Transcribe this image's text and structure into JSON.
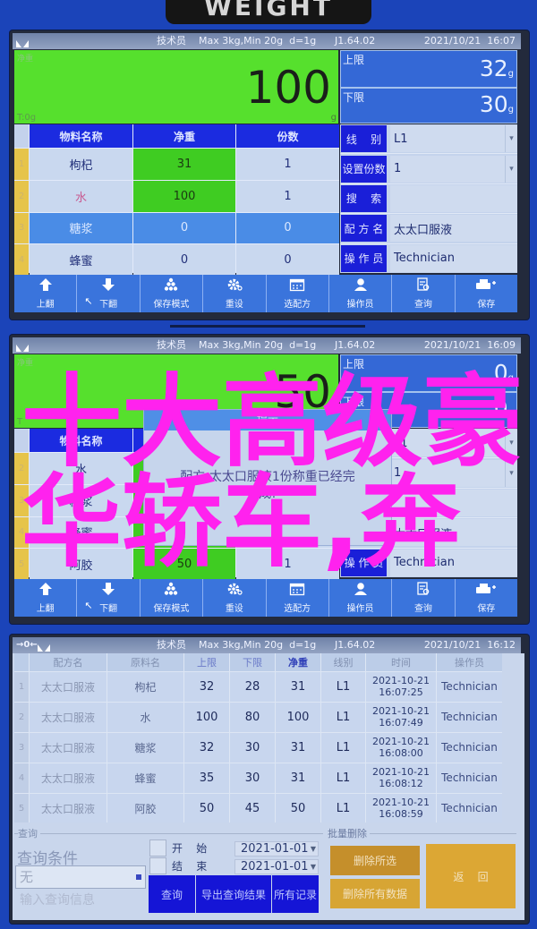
{
  "device": {
    "brand_label": "WEIGHT"
  },
  "colors": {
    "bezel_blue": "#1b44b9",
    "weight_green": "#56e02d",
    "header_blue": "#1b2be0",
    "button_blue": "#1515d6",
    "gold": "#d7a534",
    "overlay_magenta": "#ff22ee"
  },
  "toolbar": [
    {
      "label": "上翻",
      "icon": "arrow-up-icon"
    },
    {
      "label": "下翻",
      "icon": "arrow-down-icon"
    },
    {
      "label": "保存模式",
      "icon": "stack-icon"
    },
    {
      "label": "重设",
      "icon": "gear-icon"
    },
    {
      "label": "选配方",
      "icon": "calendar-icon"
    },
    {
      "label": "操作员",
      "icon": "user-icon"
    },
    {
      "label": "查询",
      "icon": "document-search-icon"
    },
    {
      "label": "保存",
      "icon": "printer-plus-icon"
    }
  ],
  "screens": [
    {
      "header": {
        "role": "技术员",
        "spec": "Max 3kg,Min 20g  d=1g",
        "version": "J1.64.02",
        "datetime": "2021/10/21  16:07"
      },
      "weight": {
        "label": "净重",
        "value": "100",
        "tare": "T:0g",
        "unit": "g"
      },
      "limits": {
        "upper_label": "上限",
        "upper_value": "32",
        "lower_label": "下限",
        "lower_value": "30",
        "unit": "g"
      },
      "table": {
        "columns": [
          "物料名称",
          "净重",
          "份数"
        ],
        "rows": [
          {
            "index": "1",
            "name": "枸杞",
            "net": "31",
            "count": "1"
          },
          {
            "index": "2",
            "name": "水",
            "net": "100",
            "count": "1"
          },
          {
            "index": "3",
            "name": "糖浆",
            "net": "0",
            "count": "0"
          },
          {
            "index": "4",
            "name": "蜂蜜",
            "net": "0",
            "count": "0"
          }
        ]
      },
      "form": [
        {
          "label": "线    别",
          "value": "L1"
        },
        {
          "label": "设置份数",
          "value": "1"
        },
        {
          "label": "搜    索",
          "value": ""
        },
        {
          "label": "配 方 名",
          "value": "太太口服液"
        },
        {
          "label": "操 作 员",
          "value": "Technician"
        }
      ]
    },
    {
      "header": {
        "role": "技术员",
        "spec": "Max 3kg,Min 20g  d=1g",
        "version": "J1.64.02",
        "datetime": "2021/10/21  16:09"
      },
      "weight": {
        "label": "净重",
        "value": "50",
        "tare": "T",
        "unit": ""
      },
      "limits": {
        "upper_label": "上限",
        "upper_value": "0",
        "lower_label": "下限",
        "lower_value": "0",
        "unit": "g"
      },
      "table": {
        "columns": [
          "物料名称",
          "",
          ""
        ],
        "rows": [
          {
            "index": "2",
            "name": "水",
            "net": "",
            "count": ""
          },
          {
            "index": "3",
            "name": "糖浆",
            "net": "",
            "count": ""
          },
          {
            "index": "4",
            "name": "蜂蜜",
            "net": "",
            "count": ""
          },
          {
            "index": "5",
            "name": "阿胶",
            "net": "50",
            "count": "1"
          }
        ]
      },
      "form": [
        {
          "label": "",
          "value": "L1"
        },
        {
          "label": "",
          "value": "1"
        },
        {
          "label": "",
          "value": ""
        },
        {
          "label": "",
          "value": "太太口服液"
        },
        {
          "label": "操 作 员",
          "value": "Technician"
        }
      ],
      "popup": {
        "title": "提示",
        "message_line1": "配方:太太口服液1份称重已经完",
        "message_line2": "成!"
      }
    },
    {
      "header": {
        "zero": "→0←",
        "role": "技术员",
        "spec": "Max 3kg,Min 20g  d=1g",
        "version": "J1.64.02",
        "datetime": "2021/10/21  16:12"
      },
      "records": {
        "columns": [
          "配方名",
          "原料名",
          "上限",
          "下限",
          "净重",
          "线别",
          "时间",
          "操作员"
        ],
        "rows": [
          {
            "index": "1",
            "recipe": "太太口服液",
            "material": "枸杞",
            "upper": "32",
            "lower": "28",
            "net": "31",
            "line": "L1",
            "date": "2021-10-21",
            "time": "16:07:25",
            "operator": "Technician"
          },
          {
            "index": "2",
            "recipe": "太太口服液",
            "material": "水",
            "upper": "100",
            "lower": "80",
            "net": "100",
            "line": "L1",
            "date": "2021-10-21",
            "time": "16:07:49",
            "operator": "Technician"
          },
          {
            "index": "3",
            "recipe": "太太口服液",
            "material": "糖浆",
            "upper": "32",
            "lower": "30",
            "net": "31",
            "line": "L1",
            "date": "2021-10-21",
            "time": "16:08:00",
            "operator": "Technician"
          },
          {
            "index": "4",
            "recipe": "太太口服液",
            "material": "蜂蜜",
            "upper": "35",
            "lower": "30",
            "net": "31",
            "line": "L1",
            "date": "2021-10-21",
            "time": "16:08:12",
            "operator": "Technician"
          },
          {
            "index": "5",
            "recipe": "太太口服液",
            "material": "阿胶",
            "upper": "50",
            "lower": "45",
            "net": "50",
            "line": "L1",
            "date": "2021-10-21",
            "time": "16:08:59",
            "operator": "Technician"
          }
        ]
      },
      "query": {
        "group_label": "查询",
        "condition_label": "查询条件",
        "condition_value": "无",
        "input_placeholder": "输入查询信息",
        "start_label": "开    始",
        "end_label": "结    束",
        "start_date": "2021-01-01",
        "end_date": "2021-01-01",
        "search_button": "查询",
        "export_button": "导出查询结果",
        "all_button": "所有记录"
      },
      "batch_delete": {
        "group_label": "批量删除",
        "delete_selected": "删除所选",
        "delete_all": "删除所有数据",
        "back": "返    回"
      }
    }
  ],
  "overlay": {
    "line1": "十大高级豪",
    "line2": "华轿车,奔"
  }
}
